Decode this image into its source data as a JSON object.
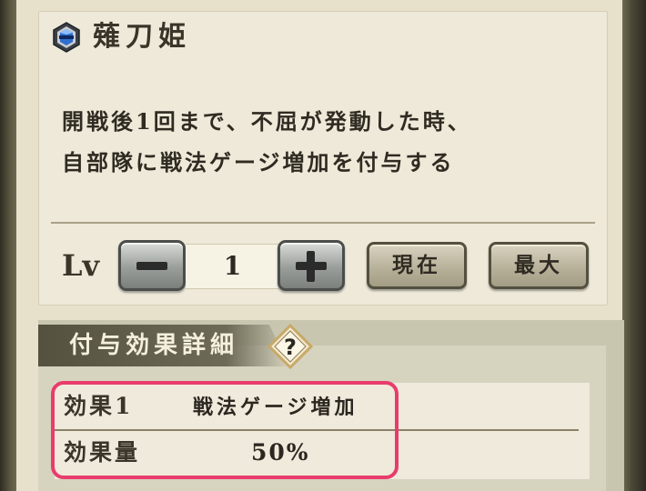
{
  "skill": {
    "name": "薙刀姫",
    "icon": "blue-gem-badge-icon",
    "description_lines": [
      "開戦後1回まで、不屈が発動した時、",
      "自部隊に戦法ゲージ増加を付与する"
    ]
  },
  "level": {
    "label": "Lv",
    "value": "1",
    "current_label": "現在",
    "max_label": "最大"
  },
  "detail": {
    "title": "付与効果詳細",
    "help_glyph": "?",
    "rows": [
      {
        "label": "効果1",
        "value": "戦法ゲージ増加"
      },
      {
        "label": "効果量",
        "value": "50%"
      }
    ]
  },
  "colors": {
    "highlight": "#e83c6c",
    "parchment": "#eee9d8",
    "header_bar": "#54523f"
  }
}
